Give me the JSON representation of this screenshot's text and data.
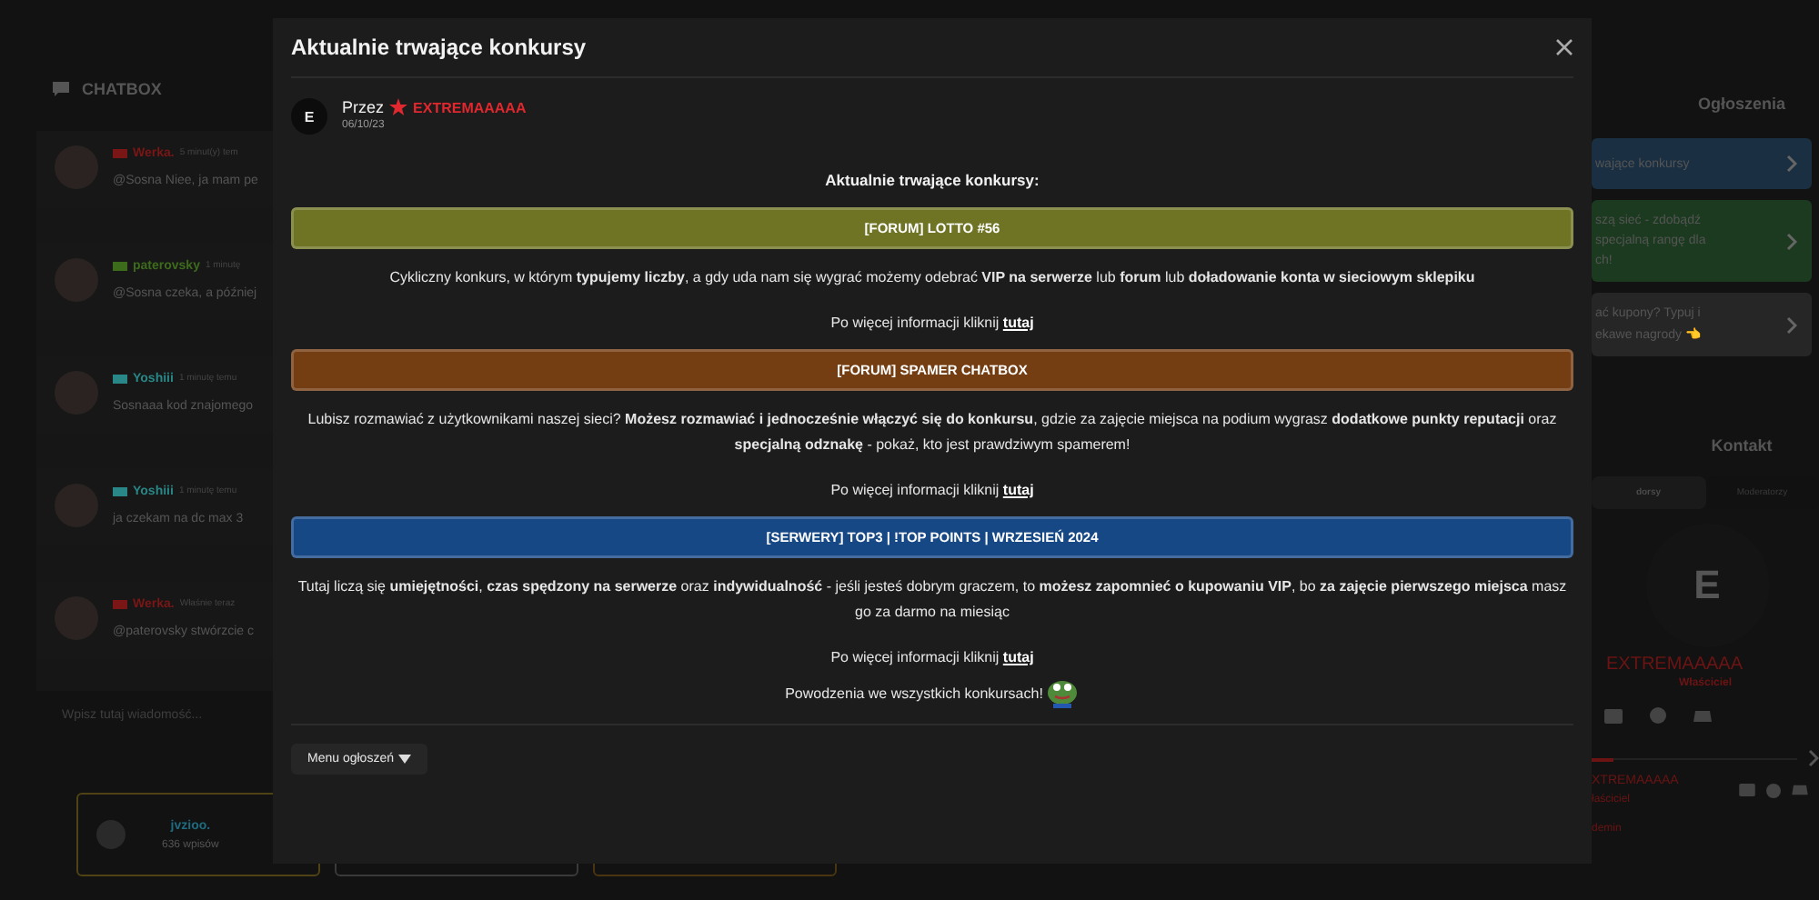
{
  "chatbox": {
    "title": "CHATBOX",
    "messages": [
      {
        "author": "Werka.",
        "color": "#7a1616",
        "time": "5 minut(y) tem",
        "text": "@Sosna Niee, ja mam pe"
      },
      {
        "author": "paterovsky",
        "color": "#3d6b1c",
        "time": "1 minutę",
        "text": "@Sosna czeka, a później"
      },
      {
        "author": "Yoshiii",
        "color": "#2a8787",
        "time": "1 minutę temu",
        "text": "Sosnaaa kod znajomego"
      },
      {
        "author": "Yoshiii",
        "color": "#2a8787",
        "time": "1 minutę temu",
        "text": "ja czekam na dc max 3"
      },
      {
        "author": "Werka.",
        "color": "#7a1616",
        "time": "Właśnie teraz",
        "text": "@paterovsky stwórzcie c"
      }
    ],
    "placeholder": "Wpisz tutaj wiadomość...",
    "user_card": {
      "name": "jvzioo.",
      "posts": "636 wpisów"
    }
  },
  "announcements": {
    "title": "Ogłoszenia",
    "items": [
      {
        "lines": [
          "wające konkursy"
        ],
        "color": "#1a2f42"
      },
      {
        "lines": [
          "szą sieć - zdobądź",
          "specjalną rangę dla",
          "ch!"
        ],
        "color": "#1b3a1f"
      },
      {
        "lines": [
          "ać kupony? Typuj i",
          "ekawe nagrody 👈"
        ],
        "color": "#262626"
      }
    ]
  },
  "contact": {
    "title": "Kontakt",
    "tabs": [
      {
        "label": "dorsy",
        "selected": true
      },
      {
        "label": "Moderatorzy",
        "selected": false
      }
    ],
    "avatar": "E",
    "name": "EXTREMAAAAA",
    "role": "Właściciel",
    "second_name": "XTREMAAAAA",
    "second_role": "łaściciel",
    "next_role": "demin"
  },
  "modal": {
    "title": "Aktualnie trwające konkursy",
    "author_prefix": "Przez",
    "author_avatar": "E",
    "author": "EXTREMAAAAA",
    "date": "06/10/23",
    "heading": "Aktualnie trwające konkursy:",
    "contests": [
      {
        "title": "[FORUM] LOTTO #56",
        "color": "#6f7424",
        "description": "Cykliczny konkurs, w którym **typujemy liczby**, a gdy uda nam się wygrać możemy odebrać **VIP na serwerze** lub **forum** lub **doładowanie konta w sieciowym sklepiku**",
        "more": "Po więcej informacji kliknij",
        "link": "tutaj"
      },
      {
        "title": "[FORUM] SPAMER CHATBOX",
        "color": "#743d12",
        "description": "Lubisz rozmawiać z użytkownikami naszej sieci? **Możesz rozmawiać i jednocześnie włączyć się do konkursu**, gdzie za zajęcie miejsca na podium wygrasz **dodatkowe punkty reputacji** oraz **specjalną odznakę** - pokaż, kto jest prawdziwym spamerem!",
        "more": "Po więcej informacji kliknij",
        "link": "tutaj"
      },
      {
        "title": "[SERWERY] TOP3 | !TOP POINTS | WRZESIEŃ 2024",
        "color": "#164886",
        "description": "Tutaj liczą się **umiejętności**, **czas spędzony na serwerze** oraz **indywidualność** - jeśli jesteś dobrym graczem, to **możesz zapomnieć o kupowaniu VIP**, bo **za zajęcie pierwszego miejsca** masz go za darmo na miesiąc",
        "more": "Po więcej informacji kliknij",
        "link": "tutaj"
      }
    ],
    "closing": "Powodzenia we wszystkich konkursach!",
    "menu_button": "Menu ogłoszeń"
  }
}
